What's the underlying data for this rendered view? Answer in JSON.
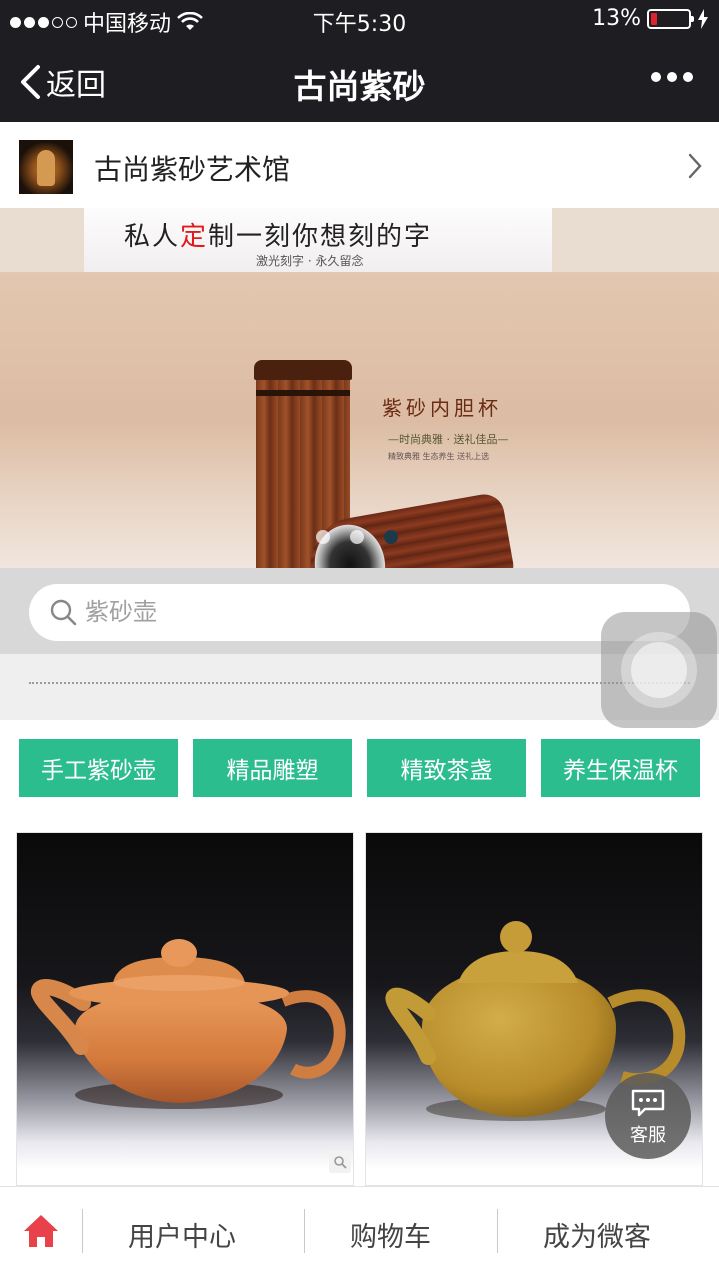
{
  "status_bar": {
    "carrier": "中国移动",
    "time": "下午5:30",
    "battery": "13%",
    "battery_level": 0.13
  },
  "navbar": {
    "back_label": "返回",
    "title": "古尚紫砂"
  },
  "shop": {
    "name": "古尚紫砂艺术馆"
  },
  "banner": {
    "headline_part1": "私人",
    "headline_highlight": "定",
    "headline_part2": "制一刻你想刻的字",
    "subline": "激光刻字 · 永久留念",
    "product_title": "紫砂内胆杯",
    "product_tagline": "—时尚典雅 · 送礼佳品—",
    "product_small": "精致典雅 生态养生 送礼上选",
    "slide_count": 3,
    "active_slide": 3
  },
  "search": {
    "placeholder": "紫砂壶"
  },
  "categories": [
    {
      "label": "手工紫砂壶"
    },
    {
      "label": "精品雕塑"
    },
    {
      "label": "精致茶盏"
    },
    {
      "label": "养生保温杯"
    }
  ],
  "customer_service": {
    "label": "客服"
  },
  "tabbar": {
    "items": [
      {
        "label": "用户中心"
      },
      {
        "label": "购物车"
      },
      {
        "label": "成为微客"
      }
    ]
  },
  "colors": {
    "dark_bar": "#1e1e22",
    "accent_green": "#2cbd8e",
    "home_red": "#e8414a"
  }
}
